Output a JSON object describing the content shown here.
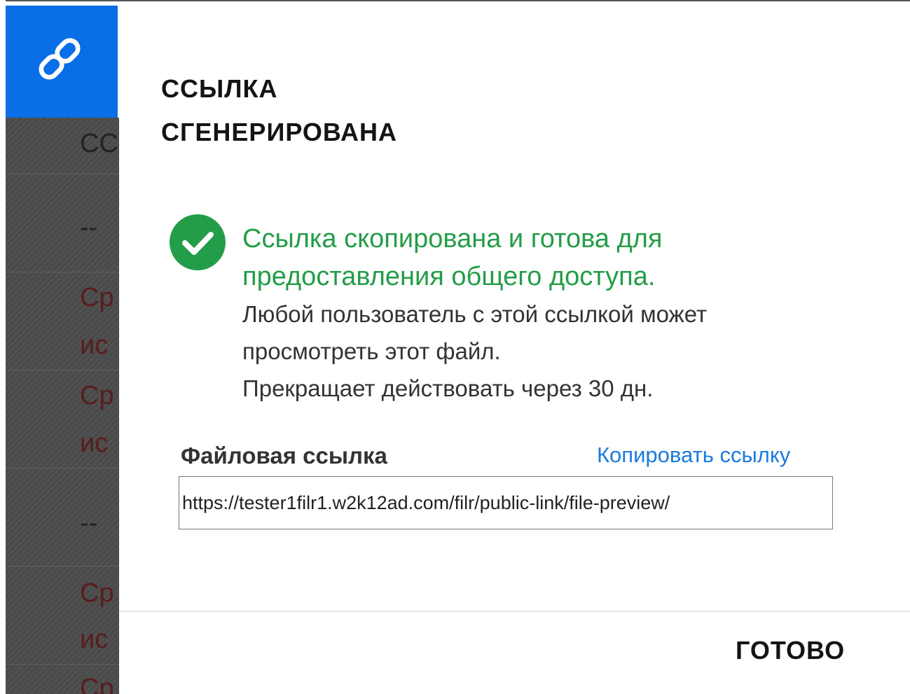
{
  "background": {
    "rows": [
      {
        "text": "СС",
        "class": "dark"
      },
      {
        "text": "--",
        "class": "dark"
      },
      {
        "text": "Ср",
        "class": "red"
      },
      {
        "text": "ис",
        "class": "red"
      },
      {
        "text": "Ср",
        "class": "red"
      },
      {
        "text": "ис",
        "class": "red"
      },
      {
        "text": "--",
        "class": "dark"
      },
      {
        "text": "Ср",
        "class": "red"
      },
      {
        "text": "ис",
        "class": "red"
      },
      {
        "text": "Ср",
        "class": "red"
      }
    ]
  },
  "header": {
    "icon": "link-chain-icon",
    "title_line1": "ССЫЛКА",
    "title_line2": "СГЕНЕРИРОВАНА",
    "tile_color": "#0a6ee6"
  },
  "status": {
    "icon": "check-circle-icon",
    "color": "#249d48",
    "message_line1": "Ссылка скопирована и готова для",
    "message_line2": "предоставления общего доступа.",
    "desc_line1": "Любой пользователь с этой ссылкой может",
    "desc_line2": "просмотреть этот файл.",
    "desc_line3": "Прекращает действовать через 30 дн."
  },
  "file_link": {
    "label": "Файловая ссылка",
    "copy_label": "Копировать ссылку",
    "value": "https://tester1filr1.w2k12ad.com/filr/public-link/file-preview/"
  },
  "footer": {
    "done_label": "ГОТОВО"
  }
}
